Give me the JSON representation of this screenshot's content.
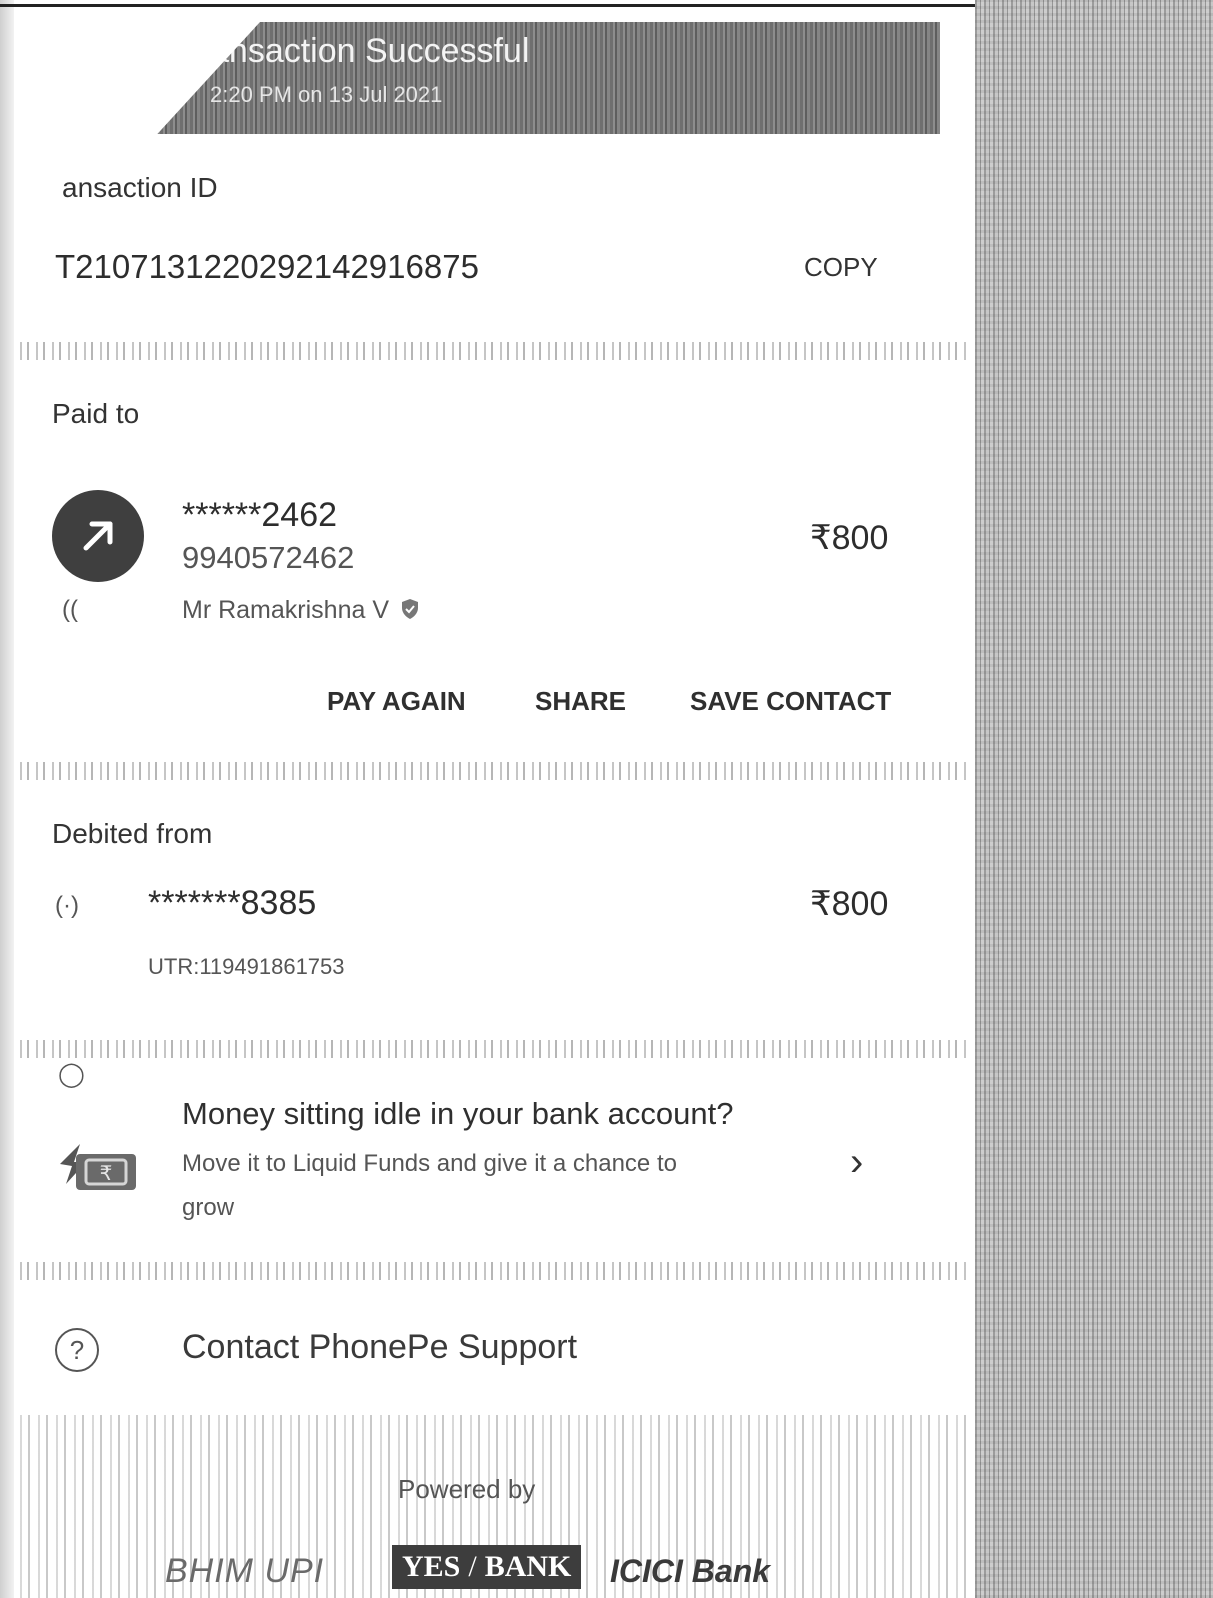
{
  "header": {
    "title": "ansaction Successful",
    "subtitle": "2:20 PM on 13 Jul 2021"
  },
  "transaction": {
    "label": "ansaction ID",
    "id": "T2107131220292142916875",
    "copy_label": "COPY"
  },
  "paid_to": {
    "label": "Paid to",
    "masked_number": "******2462",
    "phone": "9940572462",
    "name": "Mr Ramakrishna  V",
    "amount": "₹800",
    "verified_icon": "verified-shield-icon"
  },
  "actions": {
    "pay_again": "PAY AGAIN",
    "share": "SHARE",
    "save_contact": "SAVE CONTACT"
  },
  "debited_from": {
    "label": "Debited from",
    "masked_account": "*******8385",
    "amount": "₹800",
    "utr": "UTR:119491861753"
  },
  "promo": {
    "title": "Money sitting idle in your bank account?",
    "body_line1": "Move it to Liquid Funds and give it a chance to",
    "body_line2": "grow"
  },
  "support": {
    "label": "Contact PhonePe Support"
  },
  "footer": {
    "powered_by": "Powered by",
    "logo_bhim": "BHIM UPI",
    "logo_yes_left": "YES",
    "logo_yes_right": "BANK",
    "logo_icici": "ICICI Bank"
  }
}
